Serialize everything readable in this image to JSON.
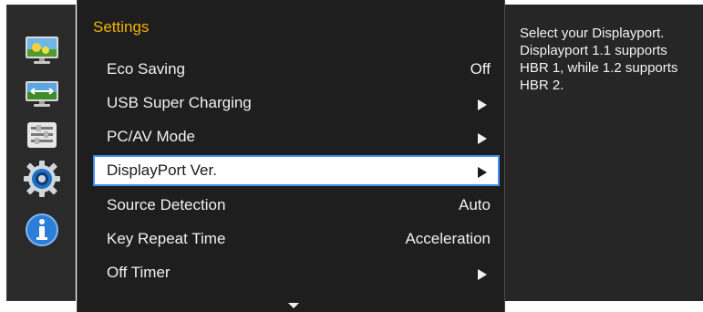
{
  "menu": {
    "title": "Settings",
    "items": [
      {
        "label": "Eco Saving",
        "value": "Off",
        "arrow": false,
        "selected": false
      },
      {
        "label": "USB Super Charging",
        "value": "",
        "arrow": true,
        "selected": false
      },
      {
        "label": "PC/AV Mode",
        "value": "",
        "arrow": true,
        "selected": false
      },
      {
        "label": "DisplayPort Ver.",
        "value": "",
        "arrow": true,
        "selected": true
      },
      {
        "label": "Source Detection",
        "value": "Auto",
        "arrow": false,
        "selected": false
      },
      {
        "label": "Key Repeat Time",
        "value": "Acceleration",
        "arrow": false,
        "selected": false
      },
      {
        "label": "Off Timer",
        "value": "",
        "arrow": true,
        "selected": false
      }
    ]
  },
  "sidebar": {
    "icons": [
      "picture-icon",
      "screen-icon",
      "onscreen-display-icon",
      "system-gear-icon",
      "information-icon"
    ],
    "active": "system-gear-icon"
  },
  "help": {
    "text": "Select your Displayport. Displayport 1.1 supports HBR 1, while 1.2 supports HBR 2."
  },
  "colors": {
    "title": "#f2b200",
    "selection_border": "#3f8ff0",
    "menu_background": "#1e1e1e"
  }
}
